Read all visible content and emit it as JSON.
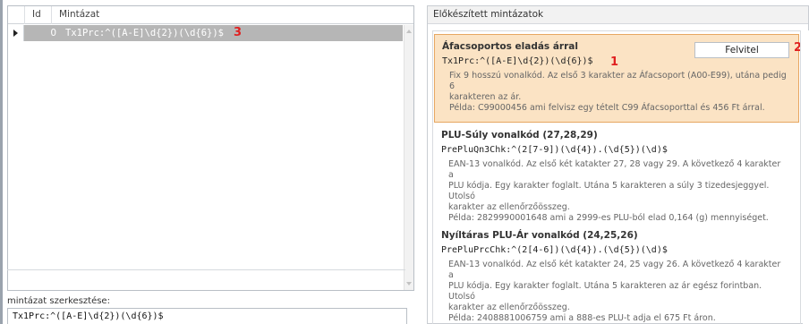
{
  "grid": {
    "columns": {
      "id": "Id",
      "pattern": "Mintázat"
    },
    "rows": [
      {
        "id": "0",
        "pattern": "Tx1Prc:^([A-E]\\d{2})(\\d{6})$"
      }
    ]
  },
  "editor": {
    "label": "mintázat szerkesztése:",
    "value": "Tx1Prc:^([A-E]\\d{2})(\\d{6})$"
  },
  "prepared": {
    "title": "Előkészített mintázatok",
    "add_button": "Felvitel",
    "items": [
      {
        "title": "Áfacsoportos eladás árral",
        "pattern": "Tx1Prc:^([A-E]\\d{2})(\\d{6})$",
        "desc": [
          "Fix 9 hosszú vonalkód. Az első 3 karakter az Áfacsoport (A00-E99), utána pedig 6",
          "karakteren az ár.",
          "Példa: C99000456 ami felvisz egy tételt C99 Áfacsoporttal és 456 Ft árral."
        ]
      },
      {
        "title": "PLU-Súly vonalkód (27,28,29)",
        "pattern": "PrePluQn3Chk:^(2[7-9])(\\d{4}).(\\d{5})(\\d)$",
        "desc": [
          "EAN-13 vonalkód. Az első két katakter 27, 28 vagy 29. A következő 4 karakter a",
          "PLU kódja. Egy karakter foglalt. Utána 5 karakteren a súly 3 tizedesjeggyel. Utolsó",
          "karakter az ellenőrzőösszeg.",
          "Példa: 2829990001648 ami a 2999-es PLU-ból elad 0,164 (g) mennyiséget."
        ]
      },
      {
        "title": "Nyíltáras PLU-Ár vonalkód (24,25,26)",
        "pattern": "PrePluPrcChk:^(2[4-6])(\\d{4}).(\\d{5})(\\d)$",
        "desc": [
          "EAN-13 vonalkód. Az első két katakter 24, 25 vagy 26. A következő 4 karakter a",
          "PLU kódja. Egy karakter foglalt. Utána 5 karakteren az ár egész forintban. Utolsó",
          "karakter az ellenőrzőösszeg.",
          "Példa: 2408881006759 ami a 888-es PLU-t adja el 675 Ft áron."
        ]
      }
    ]
  },
  "annotations": {
    "m1": "1",
    "m2": "2",
    "m3": "3"
  },
  "colors": {
    "selected_row": "#b6b6b6",
    "selected_card_bg": "#fbe3c4",
    "selected_card_border": "#e7a761",
    "marker": "#e02020"
  }
}
